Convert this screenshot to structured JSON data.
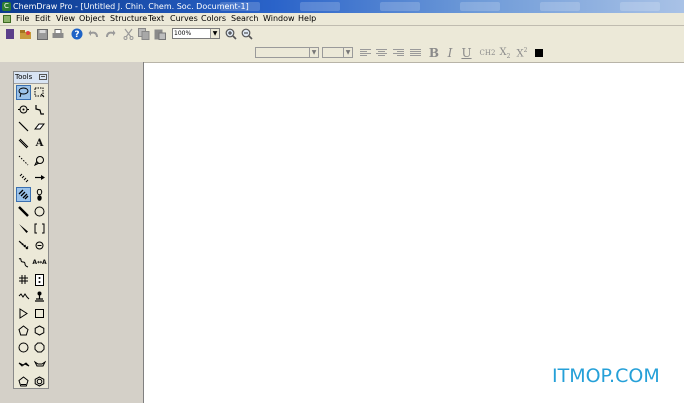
{
  "window": {
    "title": "ChemDraw Pro - [Untitled J. Chin. Chem. Soc. Document-1]",
    "app_icon": "chemdraw-app-icon"
  },
  "menubar": {
    "items": [
      "File",
      "Edit",
      "View",
      "Object",
      "Structure",
      "Text",
      "Curves",
      "Colors",
      "Search",
      "Window",
      "Help"
    ]
  },
  "toolbar": {
    "icons": [
      "new-document-icon",
      "open-icon",
      "save-icon",
      "print-icon",
      "help-icon",
      "undo-icon",
      "redo-icon",
      "cut-icon",
      "copy-icon",
      "paste-icon"
    ],
    "zoom": {
      "value": "100%"
    },
    "zoom_in_icon": "zoom-in-icon",
    "zoom_out_icon": "zoom-out-icon"
  },
  "format_toolbar": {
    "font_family": {
      "value": ""
    },
    "font_size": {
      "value": ""
    },
    "bold": "B",
    "italic": "I",
    "underline": "U",
    "formula": "CH2",
    "subscript": "X2",
    "superscript": "X2",
    "text_color": "#000000"
  },
  "tools_palette": {
    "title": "Tools",
    "tools": [
      [
        "lasso-icon",
        "marquee-icon"
      ],
      [
        "rotate-icon",
        "chain-icon"
      ],
      [
        "solid-bond-icon",
        "eraser-icon"
      ],
      [
        "double-bond-icon",
        "text-icon"
      ],
      [
        "dashed-bond-icon",
        "structure-perspective-icon"
      ],
      [
        "hashed-bond-icon",
        "arrow-icon"
      ],
      [
        "bold-hashed-bond-icon",
        "orbital-icon"
      ],
      [
        "bold-bond-icon",
        "drawing-elements-icon"
      ],
      [
        "wedge-bond-icon",
        "brackets-icon"
      ],
      [
        "hashed-wedge-bond-icon",
        "chemical-symbols-icon"
      ],
      [
        "wavy-bond-icon",
        "atom-mapping-icon"
      ],
      [
        "table-icon",
        "tlc-plate-icon"
      ],
      [
        "acyclic-chain-icon",
        "query-icon"
      ],
      [
        "cyclopropane-icon",
        "cyclobutane-icon"
      ],
      [
        "cyclopentane-icon",
        "cyclohexane-icon"
      ],
      [
        "cycloheptane-icon",
        "cyclooctane-icon"
      ],
      [
        "chair-cyclohexane-icon",
        "boat-cyclohexane-icon"
      ],
      [
        "cyclopentadiene-icon",
        "benzene-icon"
      ]
    ],
    "text_tool_label": "A",
    "atom_map_label": "A↔A"
  },
  "watermark": "ITMOP.COM"
}
